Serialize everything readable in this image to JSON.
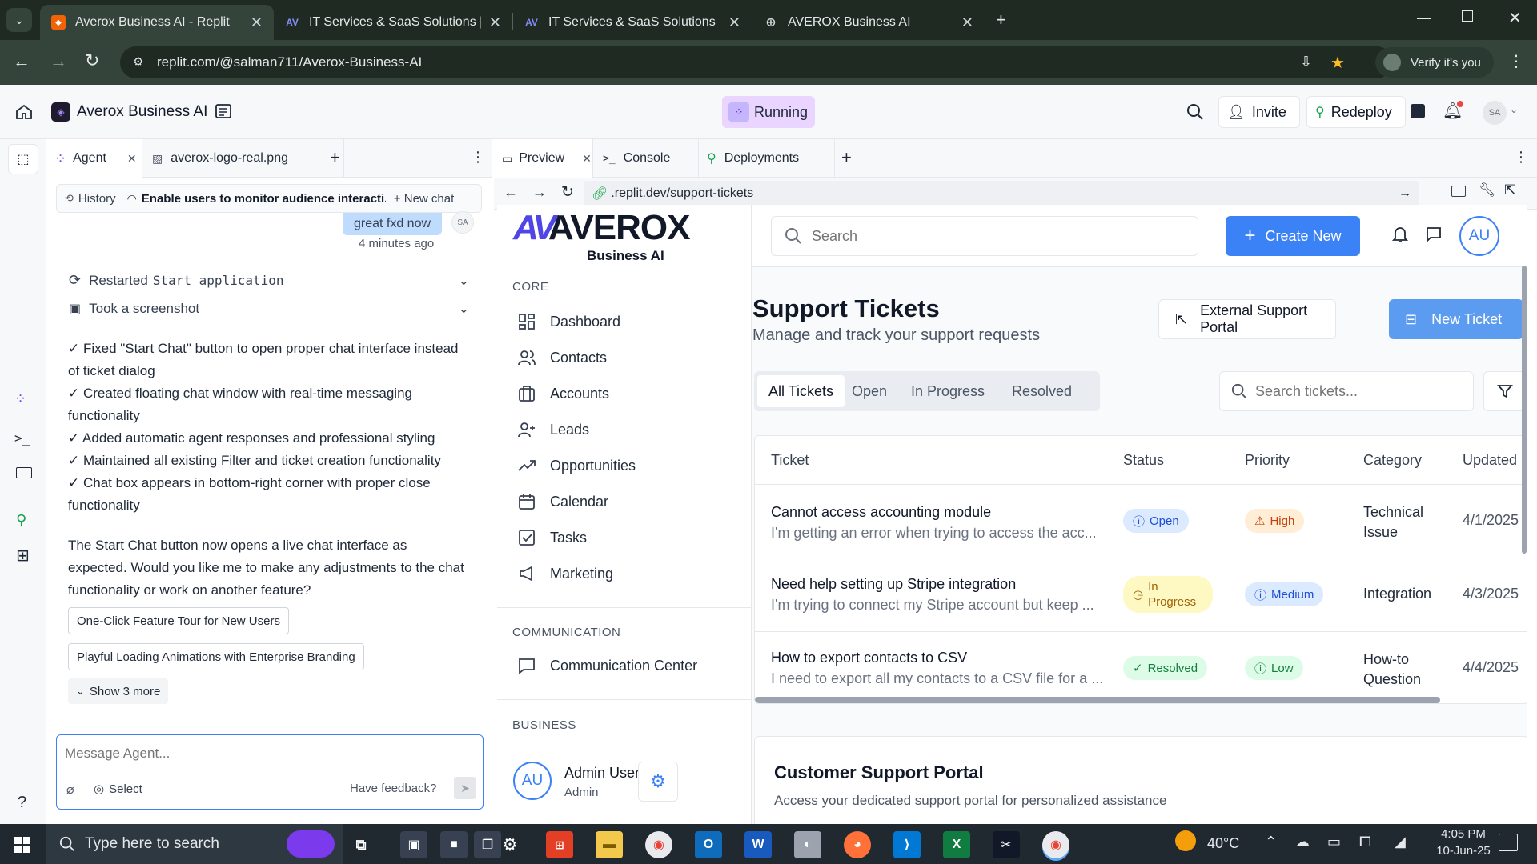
{
  "browser": {
    "tabs": [
      {
        "title": "Averox Business AI - Replit",
        "active": true
      },
      {
        "title": "IT Services & SaaS Solutions | Av",
        "active": false
      },
      {
        "title": "IT Services & SaaS Solutions | Av",
        "active": false
      },
      {
        "title": "AVEROX Business AI",
        "active": false
      }
    ],
    "url": "replit.com/@salman711/Averox-Business-AI",
    "verify_label": "Verify it's you"
  },
  "replit": {
    "project_name": "Averox Business AI",
    "status": "Running",
    "invite_label": "Invite",
    "redeploy_label": "Redeploy",
    "avatar_initials": "SA"
  },
  "agent": {
    "tabs": [
      {
        "label": "Agent"
      },
      {
        "label": "averox-logo-real.png"
      }
    ],
    "history_label": "History",
    "history_title": "Enable users to monitor audience interacti...",
    "new_chat_label": "New chat",
    "user_message": "great fxd now",
    "user_initials": "SA",
    "time_ago": "4 minutes ago",
    "actions": [
      {
        "verb": "Restarted",
        "target": "Start application"
      },
      {
        "verb": "Took a screenshot",
        "target": ""
      }
    ],
    "checklist": [
      "✓ Fixed \"Start Chat\" button to open proper chat interface instead of ticket dialog",
      "✓ Created floating chat window with real-time messaging functionality",
      "✓ Added automatic agent responses and professional styling",
      "✓ Maintained all existing Filter and ticket creation functionality",
      "✓ Chat box appears in bottom-right corner with proper close functionality"
    ],
    "summary": "The Start Chat button now opens a live chat interface as expected. Would you like me to make any adjustments to the chat functionality or work on another feature?",
    "suggestions": [
      "One-Click Feature Tour for New Users",
      "Playful Loading Animations with Enterprise Branding"
    ],
    "show_more": "Show 3 more",
    "input_placeholder": "Message Agent...",
    "select_label": "Select",
    "feedback_label": "Have feedback?"
  },
  "preview": {
    "tabs": [
      {
        "label": "Preview"
      },
      {
        "label": "Console"
      },
      {
        "label": "Deployments"
      }
    ],
    "url": ".replit.dev/support-tickets"
  },
  "app": {
    "logo_text": "AVEROX",
    "logo_mark": "AV",
    "logo_sub": "Business AI",
    "search_placeholder": "Search",
    "create_new_label": "Create New",
    "user_initials": "AU",
    "nav_sections": [
      {
        "title": "CORE",
        "items": [
          "Dashboard",
          "Contacts",
          "Accounts",
          "Leads",
          "Opportunities",
          "Calendar",
          "Tasks",
          "Marketing"
        ]
      },
      {
        "title": "COMMUNICATION",
        "items": [
          "Communication Center"
        ]
      },
      {
        "title": "BUSINESS",
        "items": []
      }
    ],
    "admin": {
      "name": "Admin User",
      "role": "Admin",
      "initials": "AU"
    },
    "page_title": "Support Tickets",
    "page_subtitle": "Manage and track your support requests",
    "external_portal_label": "External Support Portal",
    "new_ticket_label": "New Ticket",
    "filter_tabs": [
      "All Tickets",
      "Open",
      "In Progress",
      "Resolved"
    ],
    "ticket_search_placeholder": "Search tickets...",
    "columns": [
      "Ticket",
      "Status",
      "Priority",
      "Category",
      "Updated"
    ],
    "tickets": [
      {
        "title": "Cannot access accounting module",
        "desc": "I'm getting an error when trying to access the acc...",
        "status": "Open",
        "priority": "High",
        "category": "Technical Issue",
        "updated": "4/1/2025"
      },
      {
        "title": "Need help setting up Stripe integration",
        "desc": "I'm trying to connect my Stripe account but keep ...",
        "status": "In Progress",
        "priority": "Medium",
        "category": "Integration",
        "updated": "4/3/2025"
      },
      {
        "title": "How to export contacts to CSV",
        "desc": "I need to export all my contacts to a CSV file for a ...",
        "status": "Resolved",
        "priority": "Low",
        "category": "How-to Question",
        "updated": "4/4/2025"
      }
    ],
    "portal_title": "Customer Support Portal",
    "portal_subtitle": "Access your dedicated support portal for personalized assistance"
  },
  "taskbar": {
    "search_placeholder": "Type here to search",
    "temperature": "40°C",
    "time": "4:05 PM",
    "date": "10-Jun-25"
  },
  "colors": {
    "chrome_dark": "#1e2a22",
    "chrome_toolbar": "#34443a",
    "accent_blue": "#3b82f6",
    "running_bg": "#e9d5ff"
  }
}
